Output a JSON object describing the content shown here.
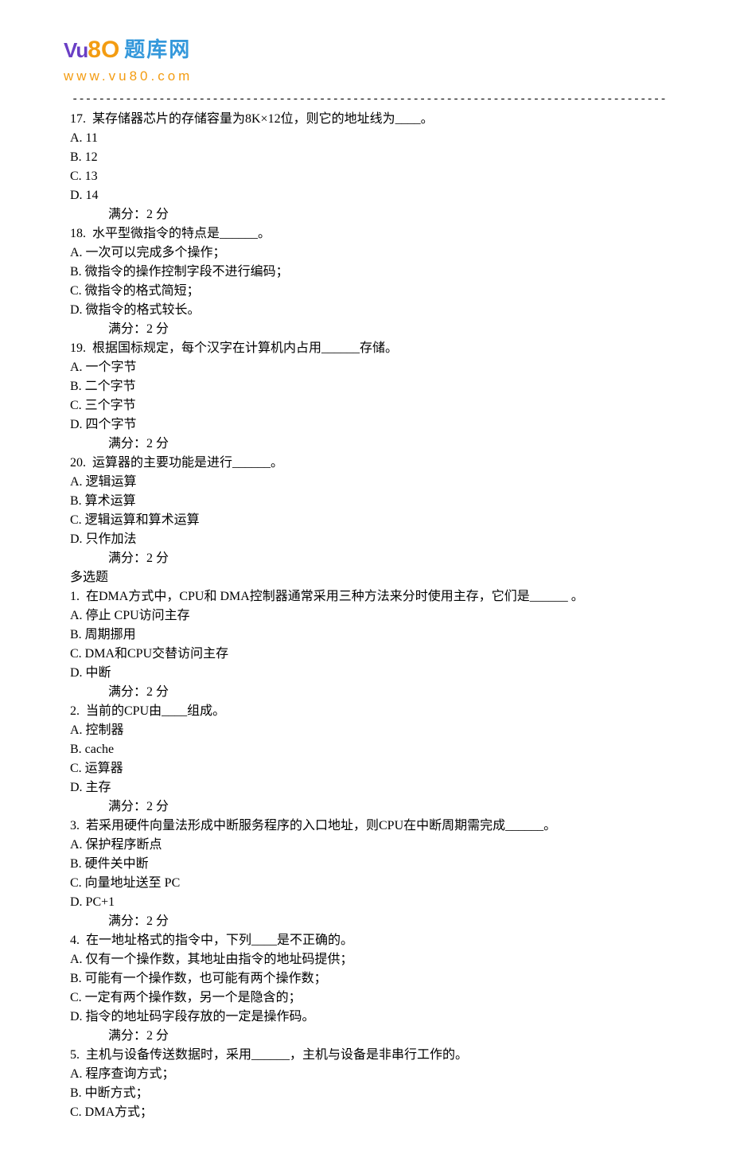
{
  "logo": {
    "prefix": "Vu",
    "big": "8O",
    "cn": "题库网",
    "url": "www.vu80.com"
  },
  "divider": "--------------------------------------------------------------------------------------------------------------------------",
  "questions": [
    {
      "number": "17.",
      "stem": "某存储器芯片的存储容量为8K×12位，则它的地址线为____。",
      "options": [
        "A. 11",
        "B. 12",
        "C. 13",
        "D. 14"
      ],
      "score": "满分：2  分"
    },
    {
      "number": "18.",
      "stem": "水平型微指令的特点是______。",
      "options": [
        "A. 一次可以完成多个操作；",
        "B. 微指令的操作控制字段不进行编码；",
        "C. 微指令的格式简短；",
        "D. 微指令的格式较长。"
      ],
      "score": "满分：2  分"
    },
    {
      "number": "19.",
      "stem": "根据国标规定，每个汉字在计算机内占用______存储。",
      "options": [
        "A. 一个字节",
        "B. 二个字节",
        "C. 三个字节",
        "D. 四个字节"
      ],
      "score": "满分：2  分"
    },
    {
      "number": "20.",
      "stem": "运算器的主要功能是进行______。",
      "options": [
        "A. 逻辑运算",
        "B. 算术运算",
        "C. 逻辑运算和算术运算",
        "D. 只作加法"
      ],
      "score": "满分：2  分"
    }
  ],
  "multiHeader": "多选题",
  "multiQuestions": [
    {
      "number": "1.",
      "stem": "在DMA方式中，CPU和 DMA控制器通常采用三种方法来分时使用主存，它们是______ 。",
      "options": [
        "A. 停止 CPU访问主存",
        "B. 周期挪用",
        "C. DMA和CPU交替访问主存",
        "D. 中断"
      ],
      "score": "满分：2  分"
    },
    {
      "number": "2.",
      "stem": "当前的CPU由____组成。",
      "options": [
        "A. 控制器",
        "B. cache",
        "C. 运算器",
        "D. 主存"
      ],
      "score": "满分：2  分"
    },
    {
      "number": "3.",
      "stem": "若采用硬件向量法形成中断服务程序的入口地址，则CPU在中断周期需完成______。",
      "options": [
        "A. 保护程序断点",
        "B. 硬件关中断",
        "C. 向量地址送至 PC",
        "D. PC+1"
      ],
      "score": "满分：2  分"
    },
    {
      "number": "4.",
      "stem": "在一地址格式的指令中，下列____是不正确的。",
      "options": [
        "A. 仅有一个操作数，其地址由指令的地址码提供；",
        "B. 可能有一个操作数，也可能有两个操作数；",
        "C. 一定有两个操作数，另一个是隐含的；",
        "D. 指令的地址码字段存放的一定是操作码。"
      ],
      "score": "满分：2  分"
    },
    {
      "number": "5.",
      "stem": "主机与设备传送数据时，采用______，主机与设备是非串行工作的。",
      "options": [
        "A. 程序查询方式；",
        "B. 中断方式；",
        "C. DMA方式；"
      ],
      "score": ""
    }
  ]
}
